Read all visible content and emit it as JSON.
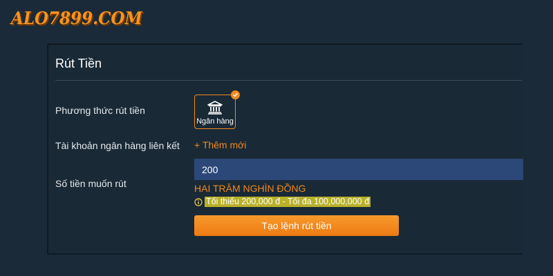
{
  "brand": {
    "logo_text": "ALO7899.COM",
    "accent_color": "#f28a1c"
  },
  "panel": {
    "title": "Rút Tiền",
    "method": {
      "label": "Phương thức rút tiền",
      "options": [
        {
          "label": "Ngân hàng",
          "icon": "bank-icon",
          "selected": true
        }
      ]
    },
    "linked_account": {
      "label": "Tài khoản ngân hàng liên kết",
      "add_label": "+ Thêm mới"
    },
    "amount": {
      "label": "Số tiền muốn rút",
      "value": "200",
      "in_words": "HAI TRĂM NGHÌN ĐỒNG",
      "limit_text": "Tối thiểu 200,000 đ - Tối đa 100,000,000 đ",
      "limit_icon": "info-icon"
    },
    "submit_label": "Tạo lệnh rút tiền"
  }
}
